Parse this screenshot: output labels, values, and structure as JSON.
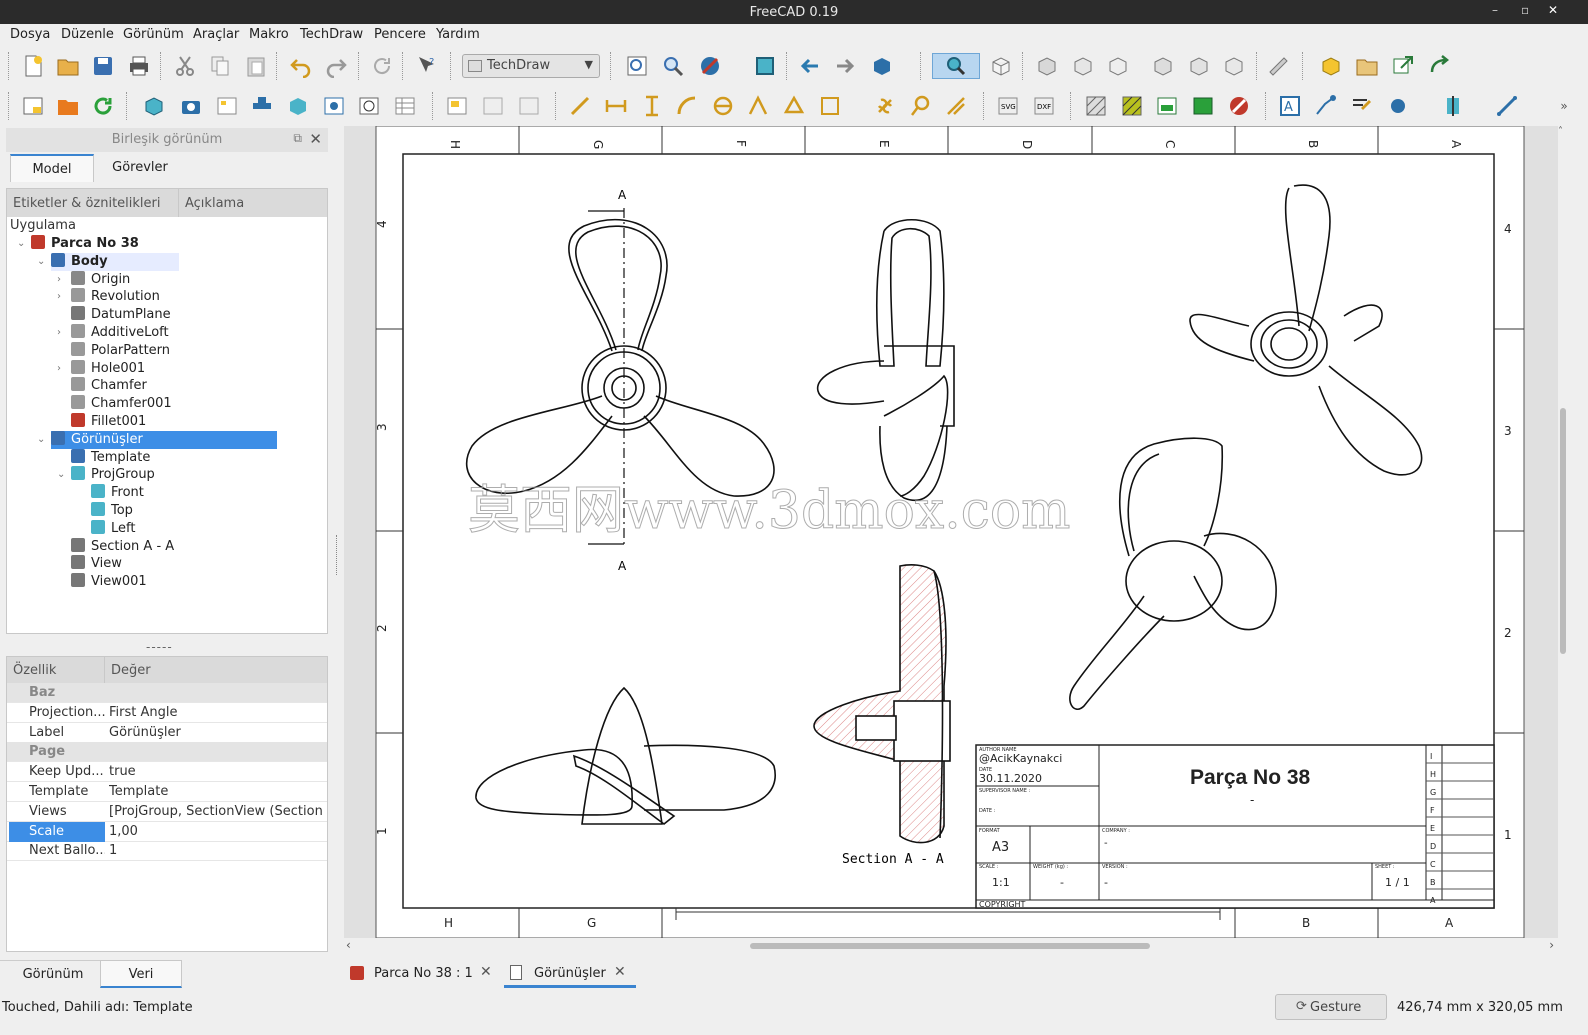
{
  "window": {
    "title": "FreeCAD 0.19",
    "controls": [
      "–",
      "▫",
      "✕"
    ]
  },
  "menubar": [
    {
      "label": "Dosya"
    },
    {
      "label": "Düzenle"
    },
    {
      "label": "Görünüm"
    },
    {
      "label": "Araçlar"
    },
    {
      "label": "Makro"
    },
    {
      "label": "TechDraw"
    },
    {
      "label": "Pencere"
    },
    {
      "label": "Yardım"
    }
  ],
  "toolbar": {
    "workbench": "TechDraw"
  },
  "combo_view": {
    "title": "Birleşik görünüm",
    "tabs": [
      "Model",
      "Görevler"
    ],
    "tree_headers": [
      "Etiketler & öznitelikleri",
      "Açıklama"
    ],
    "tree_root": "Uygulama",
    "tree": [
      {
        "label": "Parca No 38",
        "level": 1,
        "bold": true,
        "icon": "document-icon",
        "color": "#c0392b"
      },
      {
        "label": "Body",
        "level": 2,
        "bold": true,
        "icon": "body-icon",
        "color": "#3a6fb0"
      },
      {
        "label": "Origin",
        "level": 3,
        "icon": "origin-icon",
        "color": "#888"
      },
      {
        "label": "Revolution",
        "level": 3,
        "icon": "revolution-icon",
        "color": "#999"
      },
      {
        "label": "DatumPlane",
        "level": 3,
        "icon": "datum-plane-icon",
        "color": "#777"
      },
      {
        "label": "AdditiveLoft",
        "level": 3,
        "icon": "loft-icon",
        "color": "#999"
      },
      {
        "label": "PolarPattern",
        "level": 3,
        "icon": "polar-pattern-icon",
        "color": "#999"
      },
      {
        "label": "Hole001",
        "level": 3,
        "icon": "hole-icon",
        "color": "#999"
      },
      {
        "label": "Chamfer",
        "level": 3,
        "icon": "chamfer-icon",
        "color": "#999"
      },
      {
        "label": "Chamfer001",
        "level": 3,
        "icon": "chamfer-icon",
        "color": "#999"
      },
      {
        "label": "Fillet001",
        "level": 3,
        "icon": "fillet-icon",
        "color": "#c0392b"
      },
      {
        "label": "Görünüşler",
        "level": 2,
        "icon": "drawing-page-icon",
        "color": "#3a6fb0",
        "selected": true
      },
      {
        "label": "Template",
        "level": 3,
        "icon": "template-icon",
        "color": "#3a6fb0"
      },
      {
        "label": "ProjGroup",
        "level": 3,
        "icon": "proj-group-icon",
        "color": "#4ab3c8"
      },
      {
        "label": "Front",
        "level": 4,
        "icon": "view-icon",
        "color": "#4ab3c8"
      },
      {
        "label": "Top",
        "level": 4,
        "icon": "view-icon",
        "color": "#4ab3c8"
      },
      {
        "label": "Left",
        "level": 4,
        "icon": "view-icon",
        "color": "#4ab3c8"
      },
      {
        "label": "Section A - A",
        "level": 3,
        "icon": "section-view-icon",
        "color": "#777"
      },
      {
        "label": "View",
        "level": 3,
        "icon": "view-icon",
        "color": "#777"
      },
      {
        "label": "View001",
        "level": 3,
        "icon": "view-icon",
        "color": "#777"
      }
    ],
    "prop_headers": [
      "Özellik",
      "Değer"
    ],
    "properties": [
      {
        "group": "Baz"
      },
      {
        "key": "Projection...",
        "value": "First Angle"
      },
      {
        "key": "Label",
        "value": "Görünüşler"
      },
      {
        "group": "Page"
      },
      {
        "key": "Keep Upd...",
        "value": "true"
      },
      {
        "key": "Template",
        "value": "Template"
      },
      {
        "key": "Views",
        "value": "[ProjGroup, SectionView (Section ..."
      },
      {
        "key": "Scale",
        "value": "1,00",
        "selected": true
      },
      {
        "key": "Next Ballo...",
        "value": "1"
      }
    ],
    "bottom_tabs": [
      "Görünüm",
      "Veri"
    ]
  },
  "drawing": {
    "col_labels": [
      "H",
      "G",
      "F",
      "E",
      "D",
      "C",
      "B",
      "A"
    ],
    "bottom_labels": [
      "H",
      "G",
      "B",
      "A"
    ],
    "row_labels": [
      "4",
      "3",
      "2",
      "1"
    ],
    "section_label": "A",
    "section_caption": "Section  A - A",
    "watermark": "莫西网www.3dmox.com",
    "title_block": {
      "author_caption": "AUTHOR NAME",
      "author": "@AcikKaynakci",
      "date_caption": "DATE",
      "date": "30.11.2020",
      "supervisor_caption": "SUPERVISOR NAME :",
      "date2_caption": "DATE :",
      "title": "Parça No 38",
      "subtitle": "-",
      "format_caption": "FORMAT",
      "format": "A3",
      "company_caption": "COMPANY :",
      "company": "-",
      "scale_caption": "SCALE :",
      "scale": "1:1",
      "weight_caption": "WEIGHT (kg) :",
      "weight": "-",
      "version_caption": "VERSION :",
      "version": "-",
      "sheet_caption": "SHEET :",
      "sheet": "1 / 1",
      "copyright": "COPYRIGHT",
      "revisions": [
        "I",
        "H",
        "G",
        "F",
        "E",
        "D",
        "C",
        "B",
        "A"
      ]
    }
  },
  "doc_tabs": [
    {
      "label": "Parca No 38 : 1"
    },
    {
      "label": "Görünüşler",
      "active": true
    }
  ],
  "status": {
    "message": "Touched, Dahili adı: Template",
    "nav_style": "Gesture",
    "dimensions": "426,74 mm x 320,05 mm"
  }
}
